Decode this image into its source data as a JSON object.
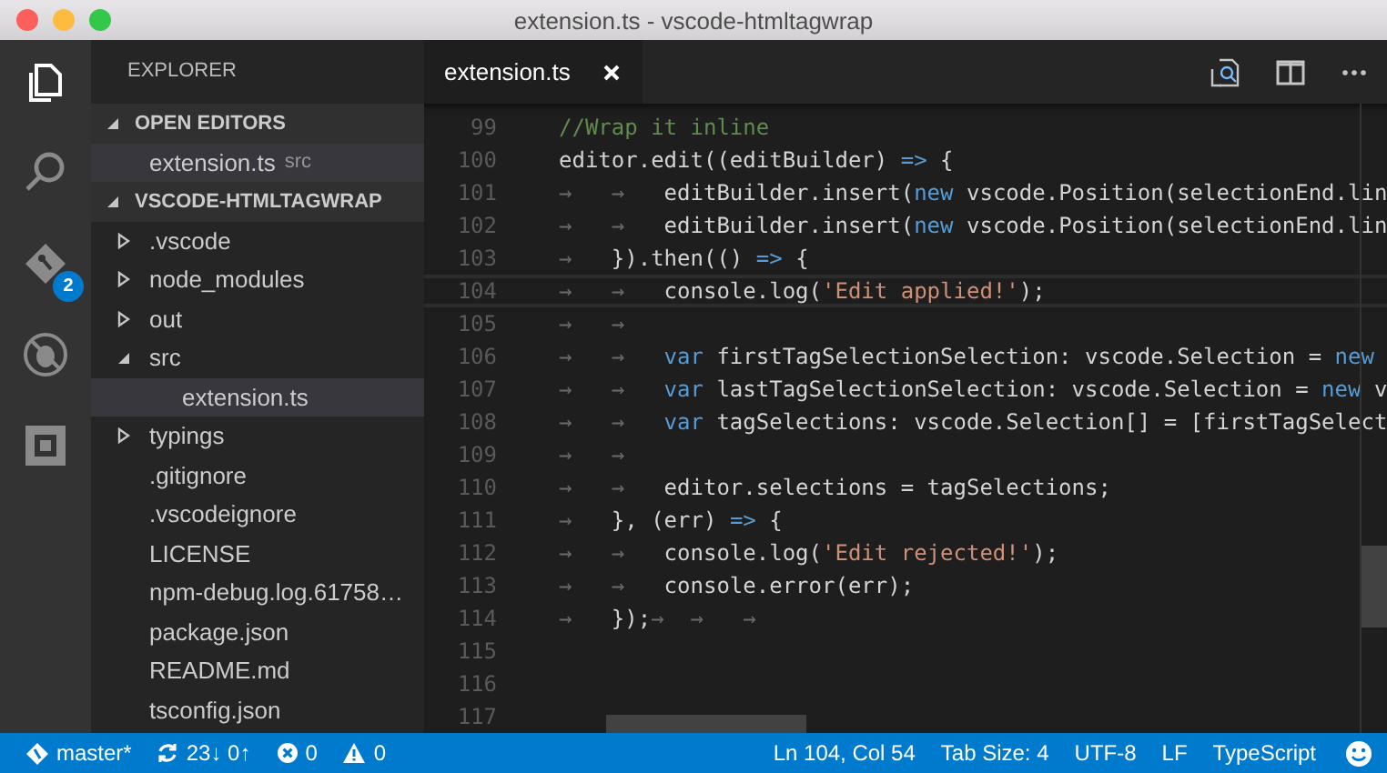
{
  "window": {
    "title": "extension.ts - vscode-htmltagwrap"
  },
  "activity_bar": {
    "items": [
      {
        "kind": "files",
        "selected": true
      },
      {
        "kind": "search",
        "selected": false
      },
      {
        "kind": "git",
        "selected": false,
        "badge": "2"
      },
      {
        "kind": "debug",
        "selected": false
      },
      {
        "kind": "extensions",
        "selected": false
      }
    ]
  },
  "sidebar": {
    "title": "EXPLORER",
    "sections": [
      {
        "title": "OPEN EDITORS",
        "expanded": true,
        "items": [
          {
            "name": "extension.ts",
            "detail": "src",
            "selected": true
          }
        ]
      },
      {
        "title": "VSCODE-HTMLTAGWRAP",
        "expanded": true,
        "items": [
          {
            "name": ".vscode",
            "expanded": false,
            "selected": false
          },
          {
            "name": "node_modules",
            "expanded": false,
            "selected": false
          },
          {
            "name": "out",
            "expanded": false,
            "selected": false
          },
          {
            "name": "src",
            "expanded": true,
            "selected": false,
            "children": [
              {
                "name": "extension.ts",
                "selected": true
              }
            ]
          },
          {
            "name": "typings",
            "expanded": false,
            "selected": false
          },
          {
            "name": ".gitignore",
            "selected": false
          },
          {
            "name": ".vscodeignore",
            "selected": false
          },
          {
            "name": "LICENSE",
            "selected": false
          },
          {
            "name": "npm-debug.log.61758…",
            "selected": false
          },
          {
            "name": "package.json",
            "selected": false
          },
          {
            "name": "README.md",
            "selected": false
          },
          {
            "name": "tsconfig.json",
            "selected": false
          }
        ]
      }
    ]
  },
  "editor": {
    "tabs": [
      {
        "label": "extension.ts",
        "selected": true
      }
    ],
    "lines": [
      {
        "number": "99",
        "current": false,
        "tokens": [
          {
            "kind": "comment",
            "text": "//Wrap it inline"
          }
        ]
      },
      {
        "number": "100",
        "current": false,
        "tokens": [
          {
            "kind": "plain",
            "text": "editor.edit((editBuilder) "
          },
          {
            "kind": "keyword",
            "text": "=>"
          },
          {
            "kind": "plain",
            "text": " {"
          }
        ]
      },
      {
        "number": "101",
        "current": false,
        "tokens": [
          {
            "kind": "ws",
            "text": "→   →   "
          },
          {
            "kind": "plain",
            "text": "editBuilder.insert("
          },
          {
            "kind": "keyword",
            "text": "new"
          },
          {
            "kind": "plain",
            "text": " vscode.Position(selectionEnd.lin"
          }
        ]
      },
      {
        "number": "102",
        "current": false,
        "tokens": [
          {
            "kind": "ws",
            "text": "→   →   "
          },
          {
            "kind": "plain",
            "text": "editBuilder.insert("
          },
          {
            "kind": "keyword",
            "text": "new"
          },
          {
            "kind": "plain",
            "text": " vscode.Position(selectionEnd.lin"
          }
        ]
      },
      {
        "number": "103",
        "current": false,
        "tokens": [
          {
            "kind": "ws",
            "text": "→   "
          },
          {
            "kind": "plain",
            "text": "}).then(() "
          },
          {
            "kind": "keyword",
            "text": "=>"
          },
          {
            "kind": "plain",
            "text": " {"
          }
        ]
      },
      {
        "number": "104",
        "current": true,
        "tokens": [
          {
            "kind": "ws",
            "text": "→   →   "
          },
          {
            "kind": "plain",
            "text": "console.log("
          },
          {
            "kind": "string",
            "text": "'Edit applied!'"
          },
          {
            "kind": "plain",
            "text": ");"
          }
        ]
      },
      {
        "number": "105",
        "current": false,
        "tokens": [
          {
            "kind": "ws",
            "text": "→   →"
          }
        ]
      },
      {
        "number": "106",
        "current": false,
        "tokens": [
          {
            "kind": "ws",
            "text": "→   →   "
          },
          {
            "kind": "keyword",
            "text": "var"
          },
          {
            "kind": "plain",
            "text": " firstTagSelectionSelection: vscode.Selection = "
          },
          {
            "kind": "keyword",
            "text": "new"
          }
        ]
      },
      {
        "number": "107",
        "current": false,
        "tokens": [
          {
            "kind": "ws",
            "text": "→   →   "
          },
          {
            "kind": "keyword",
            "text": "var"
          },
          {
            "kind": "plain",
            "text": " lastTagSelectionSelection: vscode.Selection = "
          },
          {
            "kind": "keyword",
            "text": "new"
          },
          {
            "kind": "plain",
            "text": " v"
          }
        ]
      },
      {
        "number": "108",
        "current": false,
        "tokens": [
          {
            "kind": "ws",
            "text": "→   →   "
          },
          {
            "kind": "keyword",
            "text": "var"
          },
          {
            "kind": "plain",
            "text": " tagSelections: vscode.Selection[] = [firstTagSelect"
          }
        ]
      },
      {
        "number": "109",
        "current": false,
        "tokens": [
          {
            "kind": "ws",
            "text": "→   →"
          }
        ]
      },
      {
        "number": "110",
        "current": false,
        "tokens": [
          {
            "kind": "ws",
            "text": "→   →   "
          },
          {
            "kind": "plain",
            "text": "editor.selections = tagSelections;"
          }
        ]
      },
      {
        "number": "111",
        "current": false,
        "tokens": [
          {
            "kind": "ws",
            "text": "→   "
          },
          {
            "kind": "plain",
            "text": "}, (err) "
          },
          {
            "kind": "keyword",
            "text": "=>"
          },
          {
            "kind": "plain",
            "text": " {"
          }
        ]
      },
      {
        "number": "112",
        "current": false,
        "tokens": [
          {
            "kind": "ws",
            "text": "→   →   "
          },
          {
            "kind": "plain",
            "text": "console.log("
          },
          {
            "kind": "string",
            "text": "'Edit rejected!'"
          },
          {
            "kind": "plain",
            "text": ");"
          }
        ]
      },
      {
        "number": "113",
        "current": false,
        "tokens": [
          {
            "kind": "ws",
            "text": "→   →   "
          },
          {
            "kind": "plain",
            "text": "console.error(err);"
          }
        ]
      },
      {
        "number": "114",
        "current": false,
        "tokens": [
          {
            "kind": "ws",
            "text": "→   "
          },
          {
            "kind": "plain",
            "text": "});"
          },
          {
            "kind": "ws",
            "text": "→  →   →"
          }
        ]
      },
      {
        "number": "115",
        "current": false
      },
      {
        "number": "116",
        "current": false
      },
      {
        "number": "117",
        "current": false
      }
    ]
  },
  "status_bar": {
    "left": [
      {
        "kind": "branch",
        "text": "master*"
      },
      {
        "kind": "sync",
        "text": "23↓ 0↑"
      },
      {
        "kind": "errors",
        "text": "0"
      },
      {
        "kind": "warnings",
        "text": "0"
      }
    ],
    "right": [
      {
        "kind": "text",
        "text": "Ln 104, Col 54"
      },
      {
        "kind": "text",
        "text": "Tab Size: 4"
      },
      {
        "kind": "text",
        "text": "UTF-8"
      },
      {
        "kind": "text",
        "text": "LF"
      },
      {
        "kind": "text",
        "text": "TypeScript"
      },
      {
        "kind": "feedback"
      }
    ]
  }
}
